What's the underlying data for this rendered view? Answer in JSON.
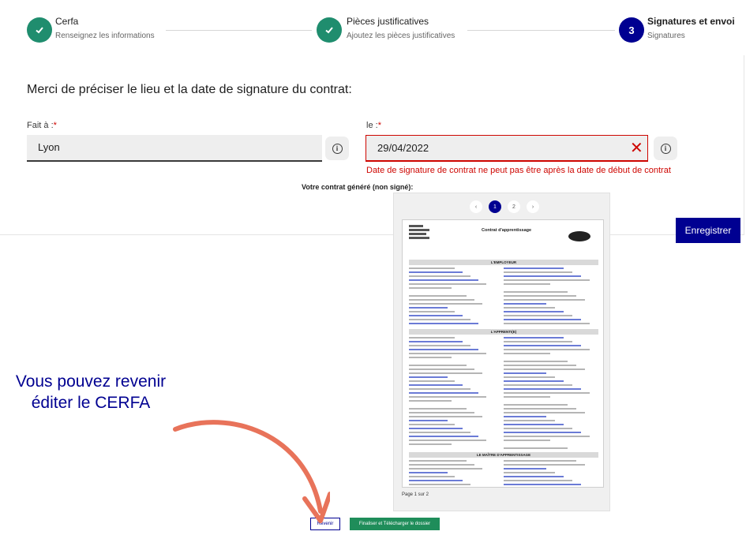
{
  "stepper": {
    "steps": [
      {
        "title": "Cerfa",
        "subtitle": "Renseignez les informations",
        "state": "done"
      },
      {
        "title": "Pièces justificatives",
        "subtitle": "Ajoutez les pièces justificatives",
        "state": "done"
      },
      {
        "number": "3",
        "title": "Signatures et envoi",
        "subtitle": "Signatures",
        "state": "current"
      }
    ]
  },
  "form": {
    "question": "Merci de préciser le lieu et la date de signature du contrat:",
    "place_label": "Fait à :",
    "place_value": "Lyon",
    "date_label": "le :",
    "required_mark": "*",
    "date_value": "29/04/2022",
    "clear_symbol": "✕",
    "error_message": "Date de signature de contrat ne peut pas être après la date de début de contrat",
    "save_label": "Enregistrer"
  },
  "preview": {
    "title": "Votre contrat généré (non signé):",
    "pages": [
      "1",
      "2"
    ],
    "current_page": "1",
    "prev_symbol": "‹",
    "next_symbol": "›",
    "doc_title": "Contrat d'apprentissage",
    "section_employer": "L'EMPLOYEUR",
    "section_apprentice": "L'APPRENTI(E)",
    "section_master": "LE MAÎTRE D'APPRENTISSAGE",
    "page_indicator": "Page 1 sur 2",
    "back_label": "Revenir",
    "finalize_label": "Finaliser et Télécharger le dossier"
  },
  "annotation": {
    "text": "Vous pouvez revenir éditer le CERFA"
  },
  "colors": {
    "primary": "#000091",
    "success": "#1f8d6e",
    "error": "#ce0500",
    "annotation_arrow": "#e8735a"
  }
}
